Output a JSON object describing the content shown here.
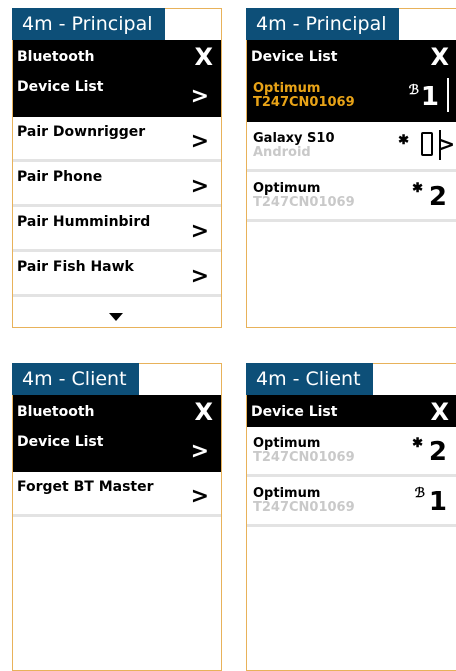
{
  "panels": {
    "tl": {
      "tag": "4m - Principal",
      "header_title": "Bluetooth",
      "close": "X",
      "items": [
        {
          "label": "Device List",
          "chevron": ">"
        },
        {
          "label": "Pair Downrigger",
          "chevron": ">"
        },
        {
          "label": "Pair Phone",
          "chevron": ">"
        },
        {
          "label": "Pair Humminbird",
          "chevron": ">"
        },
        {
          "label": "Pair Fish Hawk",
          "chevron": ">"
        }
      ]
    },
    "tr": {
      "tag": "4m - Principal",
      "header_title": "Device List",
      "close": "X",
      "devices": [
        {
          "name": "Optimum",
          "serial": "T247CN01069",
          "number": "1",
          "status_glyph": "ℬ"
        },
        {
          "name": "Galaxy S10",
          "serial": "Android",
          "status_glyph": "✱",
          "chevron": ">"
        },
        {
          "name": "Optimum",
          "serial": "T247CN01069",
          "number": "2",
          "status_glyph": "✱"
        }
      ]
    },
    "bl": {
      "tag": "4m - Client",
      "header_title": "Bluetooth",
      "close": "X",
      "items": [
        {
          "label": "Device List",
          "chevron": ">"
        },
        {
          "label": "Forget BT Master",
          "chevron": ">"
        }
      ]
    },
    "br": {
      "tag": "4m - Client",
      "header_title": "Device List",
      "close": "X",
      "devices": [
        {
          "name": "Optimum",
          "serial": "T247CN01069",
          "number": "2",
          "status_glyph": "✱"
        },
        {
          "name": "Optimum",
          "serial": "T247CN01069",
          "number": "1",
          "status_glyph": "ℬ"
        }
      ]
    }
  },
  "colors": {
    "tag_bg": "#0d4f78",
    "border": "#e8b25a",
    "highlight_text": "#e8a317",
    "serial_gray": "#c9c9c9"
  },
  "icons": {
    "scroll": "triangle-down",
    "bluetooth": "bluetooth-icon",
    "phone": "phone-icon"
  }
}
